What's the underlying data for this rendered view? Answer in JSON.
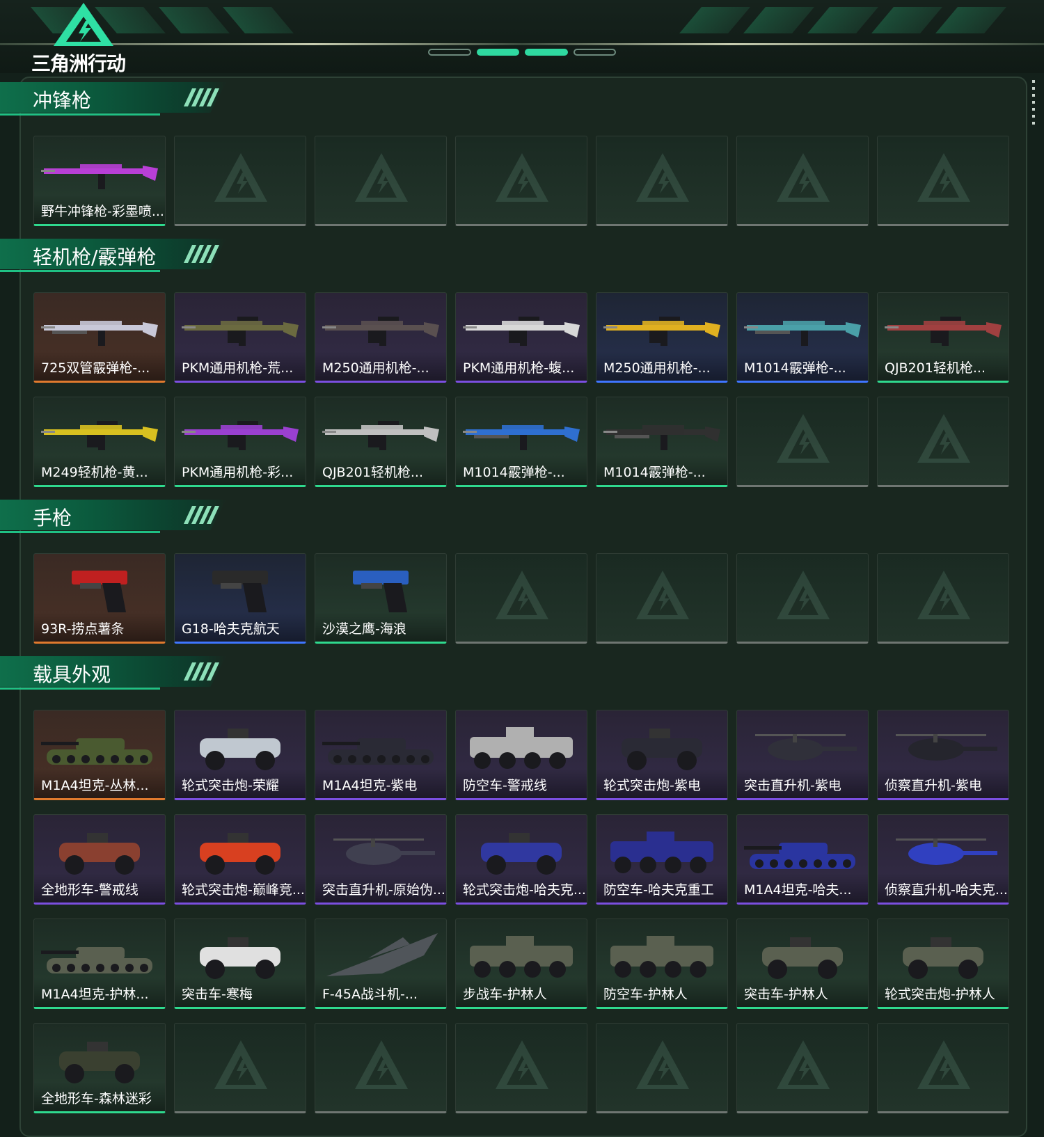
{
  "header": {
    "logo_text": "三角洲行动"
  },
  "sections": [
    {
      "title": "冲锋枪",
      "items": [
        {
          "label": "野牛冲锋枪-彩墨喷...",
          "quality": "green",
          "kind": "smg",
          "tint": "#b83fd6"
        }
      ]
    },
    {
      "title": "轻机枪/霰弹枪",
      "items": [
        {
          "label": "725双管霰弹枪-...",
          "quality": "orange",
          "kind": "shotgun",
          "tint": "#c8c8d8"
        },
        {
          "label": "PKM通用机枪-荒...",
          "quality": "purple",
          "kind": "lmg",
          "tint": "#6b6a40"
        },
        {
          "label": "M250通用机枪-...",
          "quality": "purple",
          "kind": "lmg",
          "tint": "#5a5050"
        },
        {
          "label": "PKM通用机枪-蝮...",
          "quality": "purple",
          "kind": "lmg",
          "tint": "#d8d8d8"
        },
        {
          "label": "M250通用机枪-...",
          "quality": "blue",
          "kind": "lmg",
          "tint": "#e0b020"
        },
        {
          "label": "M1014霰弹枪-...",
          "quality": "blue",
          "kind": "shotgun",
          "tint": "#4aa0a8"
        },
        {
          "label": "QJB201轻机枪...",
          "quality": "green",
          "kind": "lmg",
          "tint": "#a04040"
        },
        {
          "label": "M249轻机枪-黄...",
          "quality": "green",
          "kind": "lmg",
          "tint": "#d8c020"
        },
        {
          "label": "PKM通用机枪-彩...",
          "quality": "green",
          "kind": "lmg",
          "tint": "#9a40d0"
        },
        {
          "label": "QJB201轻机枪...",
          "quality": "green",
          "kind": "lmg",
          "tint": "#c0c0c0"
        },
        {
          "label": "M1014霰弹枪-...",
          "quality": "green",
          "kind": "shotgun",
          "tint": "#2f6fd0"
        },
        {
          "label": "M1014霰弹枪-...",
          "quality": "green",
          "kind": "shotgun",
          "tint": "#303030"
        }
      ]
    },
    {
      "title": "手枪",
      "items": [
        {
          "label": "93R-捞点薯条",
          "quality": "orange",
          "kind": "pistol",
          "tint": "#c02020"
        },
        {
          "label": "G18-哈夫克航天",
          "quality": "blue",
          "kind": "pistol",
          "tint": "#2a2a2a"
        },
        {
          "label": "沙漠之鹰-海浪",
          "quality": "green",
          "kind": "pistol",
          "tint": "#2a5fc0"
        }
      ]
    },
    {
      "title": "载具外观",
      "items": [
        {
          "label": "M1A4坦克-丛林...",
          "quality": "orange",
          "kind": "tank",
          "tint": "#4a5a30"
        },
        {
          "label": "轮式突击炮-荣耀",
          "quality": "purple",
          "kind": "car",
          "tint": "#c0c8d0"
        },
        {
          "label": "M1A4坦克-紫电",
          "quality": "purple",
          "kind": "tank",
          "tint": "#2a2a35"
        },
        {
          "label": "防空车-警戒线",
          "quality": "purple",
          "kind": "apc",
          "tint": "#b0b0b0"
        },
        {
          "label": "轮式突击炮-紫电",
          "quality": "purple",
          "kind": "car",
          "tint": "#2a2a35"
        },
        {
          "label": "突击直升机-紫电",
          "quality": "purple",
          "kind": "heli",
          "tint": "#30303a"
        },
        {
          "label": "侦察直升机-紫电",
          "quality": "purple",
          "kind": "heli",
          "tint": "#25252d"
        },
        {
          "label": "全地形车-警戒线",
          "quality": "purple",
          "kind": "atv",
          "tint": "#8a4030"
        },
        {
          "label": "轮式突击炮-巅峰竞...",
          "quality": "purple",
          "kind": "car",
          "tint": "#d84020"
        },
        {
          "label": "突击直升机-原始伪...",
          "quality": "purple",
          "kind": "heli",
          "tint": "#404050"
        },
        {
          "label": "轮式突击炮-哈夫克...",
          "quality": "purple",
          "kind": "car",
          "tint": "#3038a0"
        },
        {
          "label": "防空车-哈夫克重工",
          "quality": "purple",
          "kind": "apc",
          "tint": "#2a2f90"
        },
        {
          "label": "M1A4坦克-哈夫...",
          "quality": "purple",
          "kind": "tank",
          "tint": "#2a35a0"
        },
        {
          "label": "侦察直升机-哈夫克...",
          "quality": "purple",
          "kind": "heli",
          "tint": "#3040c0"
        },
        {
          "label": "M1A4坦克-护林...",
          "quality": "green",
          "kind": "tank",
          "tint": "#5a6050"
        },
        {
          "label": "突击车-寒梅",
          "quality": "green",
          "kind": "car",
          "tint": "#e0e0e0"
        },
        {
          "label": "F-45A战斗机-...",
          "quality": "green",
          "kind": "jet",
          "tint": "#50555a"
        },
        {
          "label": "步战车-护林人",
          "quality": "green",
          "kind": "apc",
          "tint": "#5a6050"
        },
        {
          "label": "防空车-护林人",
          "quality": "green",
          "kind": "apc",
          "tint": "#5a6050"
        },
        {
          "label": "突击车-护林人",
          "quality": "green",
          "kind": "car",
          "tint": "#5a6050"
        },
        {
          "label": "轮式突击炮-护林人",
          "quality": "green",
          "kind": "car",
          "tint": "#5a6050"
        },
        {
          "label": "全地形车-森林迷彩",
          "quality": "green",
          "kind": "atv",
          "tint": "#3a4030"
        }
      ]
    }
  ]
}
